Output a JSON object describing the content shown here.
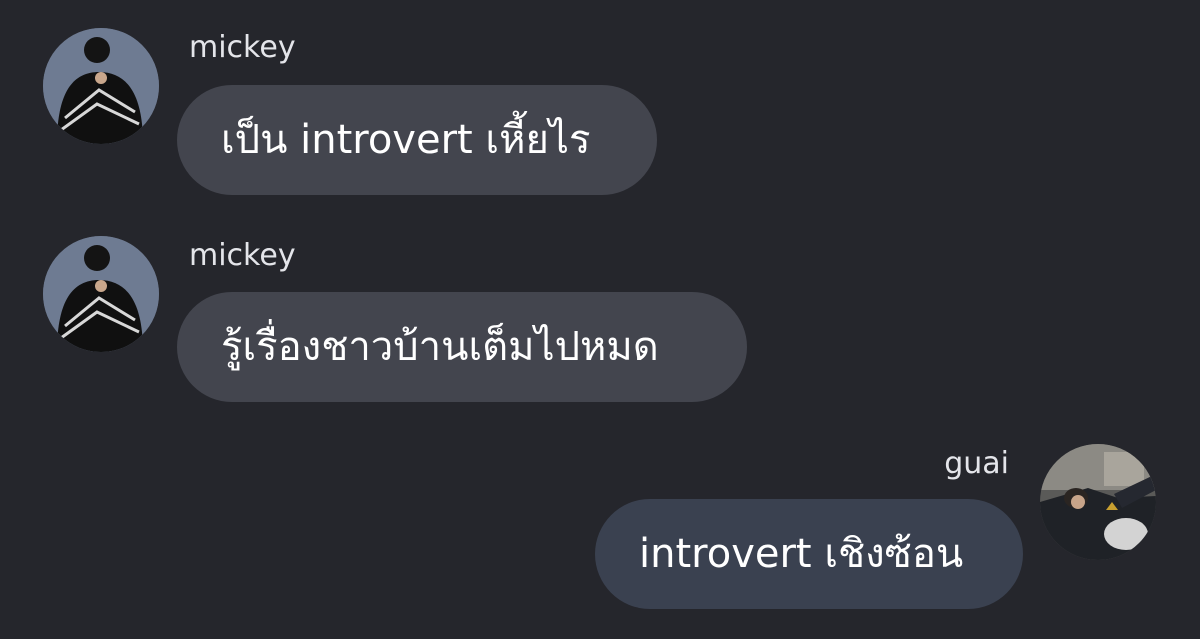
{
  "messages": [
    {
      "sender": "mickey",
      "text": "เป็น introvert เหี้ยไร",
      "direction": "incoming"
    },
    {
      "sender": "mickey",
      "text": "รู้เรื่องชาวบ้านเต็มไปหมด",
      "direction": "incoming"
    },
    {
      "sender": "guai",
      "text": "introvert เชิงซ้อน",
      "direction": "outgoing"
    }
  ],
  "colors": {
    "background": "#25262c",
    "incoming_bubble": "#43454e",
    "outgoing_bubble": "#3a4150",
    "text": "#ffffff",
    "name_text": "#e4e5ea"
  }
}
